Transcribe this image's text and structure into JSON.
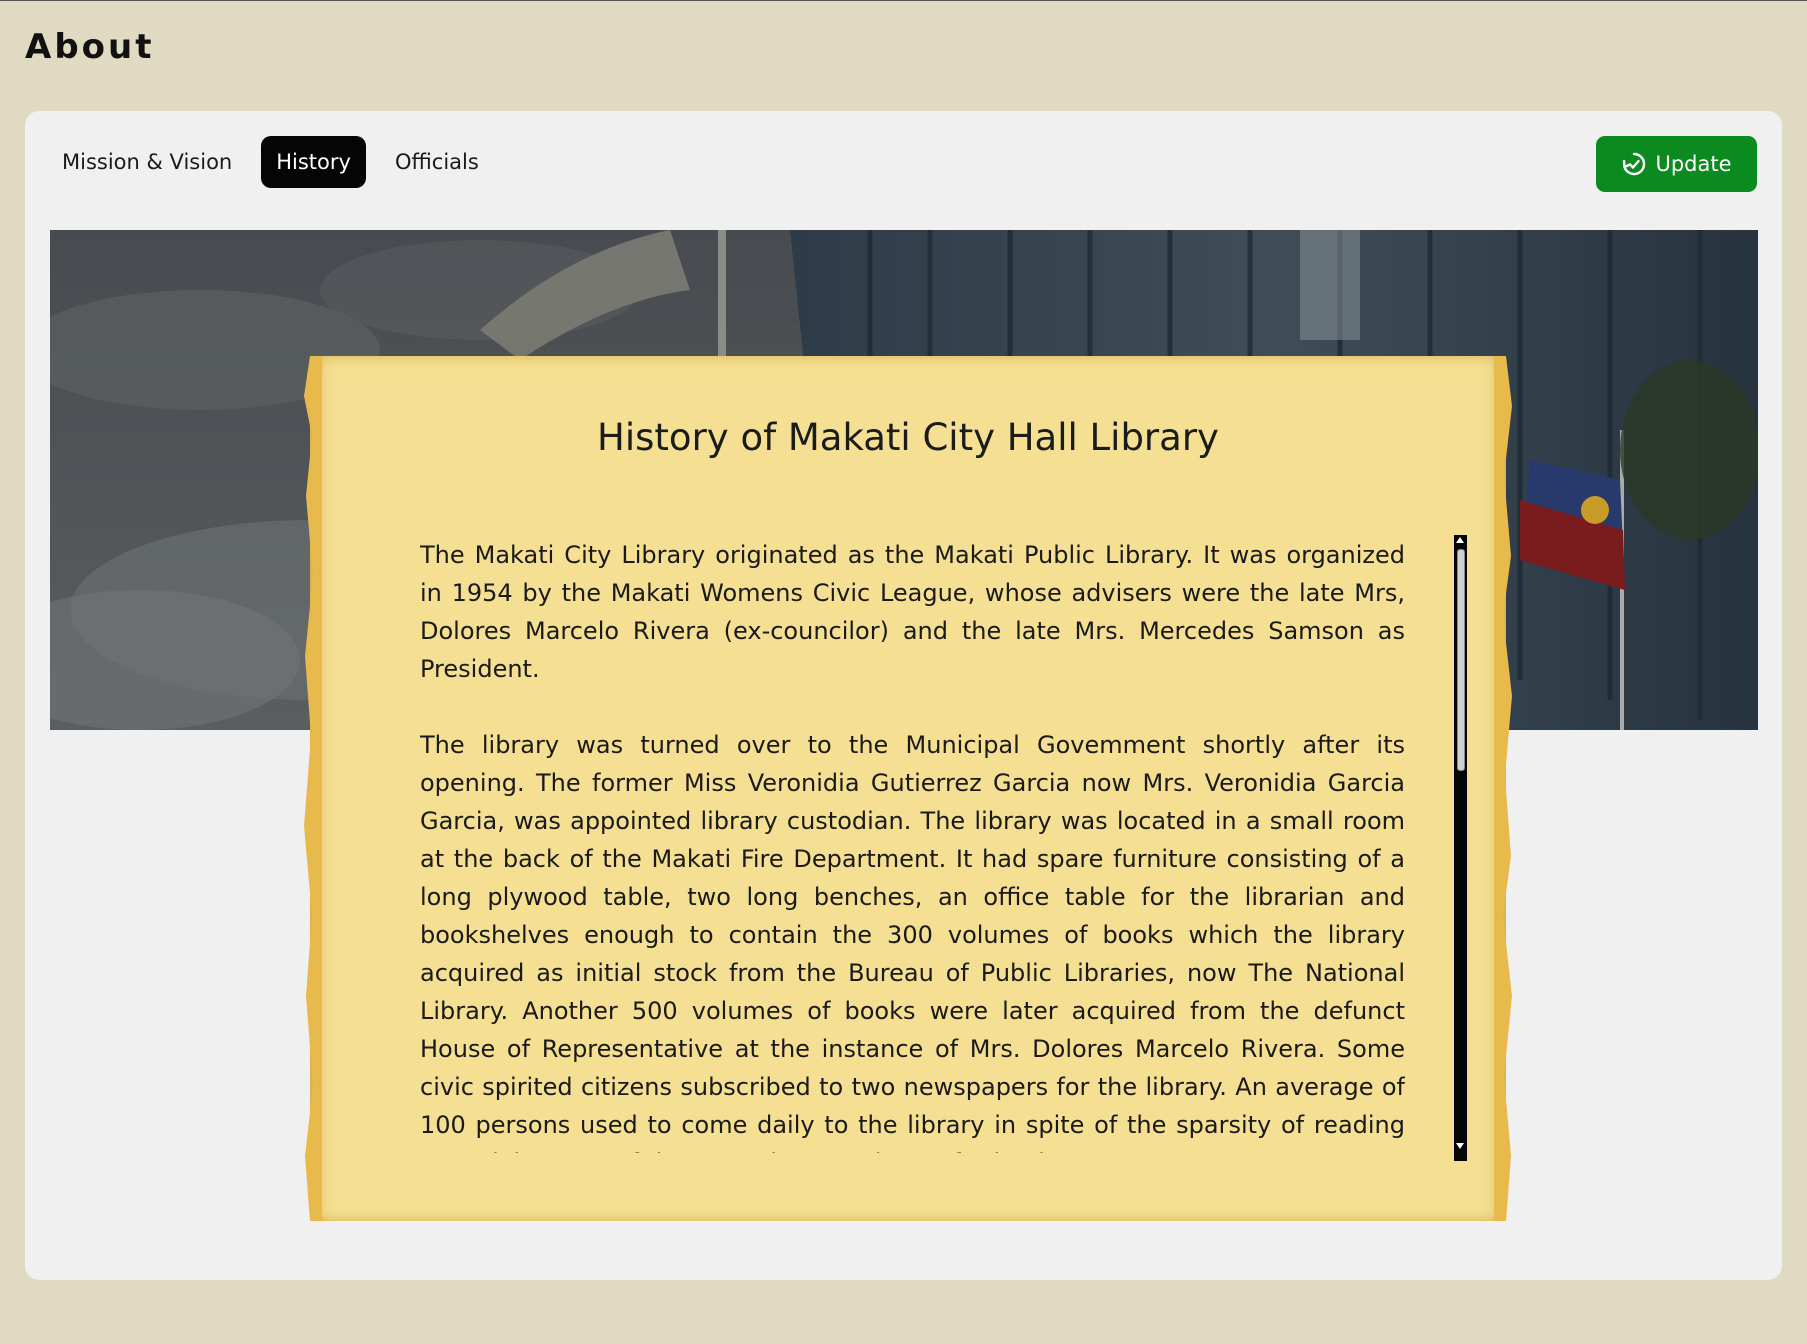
{
  "page": {
    "title": "About"
  },
  "tabs": [
    {
      "label": "Mission & Vision",
      "active": false
    },
    {
      "label": "History",
      "active": true
    },
    {
      "label": "Officials",
      "active": false
    }
  ],
  "toolbar": {
    "update_label": "Update",
    "update_icon": "refresh-check-icon",
    "accent_color": "#0a8a1f"
  },
  "history": {
    "heading": "History of Makati City Hall Library",
    "paragraphs": [
      "The Makati City Library originated as the Makati Public Library. It was organized in 1954 by the Makati Womens Civic League, whose advisers were the late Mrs, Dolores Marcelo Rivera (ex-councilor) and the late Mrs. Mercedes Samson as President.",
      "The library was turned over to the Municipal Govemment shortly after its opening. The former Miss Veronidia Gutierrez Garcia now Mrs. Veronidia Garcia Garcia, was appointed library custodian. The library was located in a small room at the back of the Makati Fire Department. It had spare furniture consisting of a long plywood table, two long benches, an office table for the librarian and bookshelves enough to contain the 300 volumes of books which the library acquired as initial stock from the Bureau of Public Libraries, now The National Library. Another 500 volumes of books were later acquired from the defunct House of Representative at the instance of Mrs. Dolores Marcelo Rivera. Some civic spirited citizens subscribed to two newspapers for the library. An average of 100 persons used to come daily to the library in spite of the sparsity of reading materials, most of them, students and out-of-school"
    ]
  }
}
